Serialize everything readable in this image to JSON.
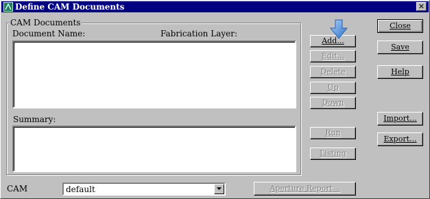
{
  "window": {
    "title": "Define CAM Documents",
    "close_glyph": "✕"
  },
  "group": {
    "title": "CAM Documents",
    "document_name_label": "Document Name:",
    "fabrication_layer_label": "Fabrication Layer:",
    "summary_label": "Summary:"
  },
  "buttons": {
    "add": "Add...",
    "edit": "Edit...",
    "delete": "Delete",
    "up": "Up",
    "down": "Down",
    "run": "Run",
    "listing": "Listing",
    "close": "Close",
    "save": "Save",
    "help": "Help",
    "import": "Import...",
    "export": "Export...",
    "aperture_report": "Aperture Report..."
  },
  "cam": {
    "label": "CAM",
    "selected": "default"
  },
  "colors": {
    "title_bar": "#000080",
    "face": "#c0c0c0",
    "cursor": "#3d86d9"
  }
}
